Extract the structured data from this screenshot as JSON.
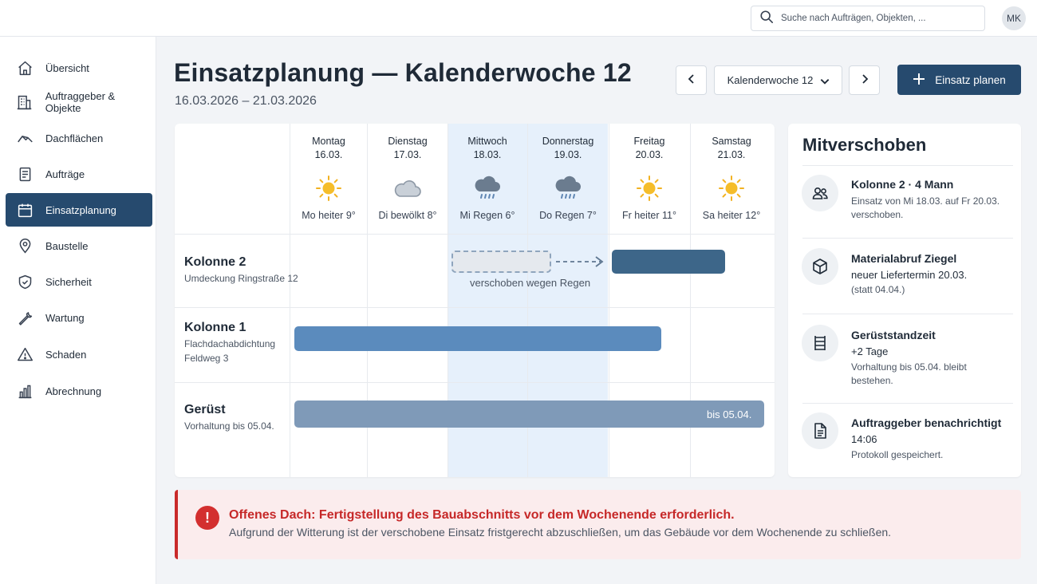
{
  "search": {
    "placeholder": "Suche nach Aufträgen, Objekten, ..."
  },
  "user": {
    "initials": "MK"
  },
  "sidebar": {
    "items": [
      {
        "label": "Übersicht",
        "icon": "home-icon"
      },
      {
        "label": "Auftraggeber & Objekte",
        "icon": "building-icon"
      },
      {
        "label": "Dachflächen",
        "icon": "roof-icon"
      },
      {
        "label": "Aufträge",
        "icon": "document-icon"
      },
      {
        "label": "Einsatzplanung",
        "icon": "calendar-icon",
        "active": true
      },
      {
        "label": "Baustelle",
        "icon": "location-pin-icon"
      },
      {
        "label": "Sicherheit",
        "icon": "shield-icon"
      },
      {
        "label": "Wartung",
        "icon": "wrench-icon"
      },
      {
        "label": "Schaden",
        "icon": "warning-icon"
      },
      {
        "label": "Abrechnung",
        "icon": "bar-chart-icon"
      }
    ]
  },
  "header": {
    "title": "Einsatzplanung — Kalenderwoche 12",
    "date_range": "16.03.2026 – 21.03.2026",
    "week_select": "Kalenderwoche 12",
    "primary_action": "Einsatz planen"
  },
  "calendar": {
    "days": [
      {
        "name": "Montag",
        "date": "16.03.",
        "weather": "sun",
        "label": "Mo heiter 9°"
      },
      {
        "name": "Dienstag",
        "date": "17.03.",
        "weather": "cloud",
        "label": "Di bewölkt 8°"
      },
      {
        "name": "Mittwoch",
        "date": "18.03.",
        "weather": "rain",
        "label": "Mi Regen 6°",
        "highlight": true
      },
      {
        "name": "Donnerstag",
        "date": "19.03.",
        "weather": "rain",
        "label": "Do Regen 7°",
        "highlight": true
      },
      {
        "name": "Freitag",
        "date": "20.03.",
        "weather": "sun",
        "label": "Fr heiter 11°"
      },
      {
        "name": "Samstag",
        "date": "21.03.",
        "weather": "sun",
        "label": "Sa heiter 12°"
      }
    ],
    "rows": [
      {
        "title": "Kolonne 2",
        "subtitle": "Umdeckung Ringstraße 12",
        "note": "verschoben wegen Regen"
      },
      {
        "title": "Kolonne 1",
        "subtitle_lines": [
          "Flachdachabdichtung",
          "Feldweg 3"
        ]
      },
      {
        "title": "Gerüst",
        "subtitle": "Vorhaltung bis 05.04.",
        "bar_label": "bis 05.04."
      }
    ],
    "colors": {
      "highlight": "#e6f0fb",
      "bar_dark": "#3d6689",
      "bar_blue": "#5b8bbd",
      "bar_grey": "#7f9ab8"
    }
  },
  "panel": {
    "title": "Mitverschoben",
    "items": [
      {
        "icon": "users-icon",
        "title": "Kolonne 2 · 4 Mann",
        "body": "Einsatz von Mi 18.03. auf Fr 20.03. verschoben."
      },
      {
        "icon": "box-icon",
        "title": "Materialabruf Ziegel",
        "line2": "neuer Liefertermin 20.03.",
        "body": "(statt 04.04.)"
      },
      {
        "icon": "scaffold-icon",
        "title": "Gerüststandzeit",
        "line2": "+2 Tage",
        "body": "Vorhaltung bis 05.04. bleibt bestehen."
      },
      {
        "icon": "file-icon",
        "title": "Auftraggeber benachrichtigt",
        "line2": "14:06",
        "body": "Protokoll gespeichert."
      }
    ]
  },
  "alert": {
    "title": "Offenes Dach: Fertigstellung des Bauabschnitts vor dem Wochenende erforderlich.",
    "text": "Aufgrund der Witterung ist der verschobene Einsatz fristgerecht abzuschließen, um das Gebäude vor dem Wochenende zu schließen.",
    "color": "#c62828"
  }
}
